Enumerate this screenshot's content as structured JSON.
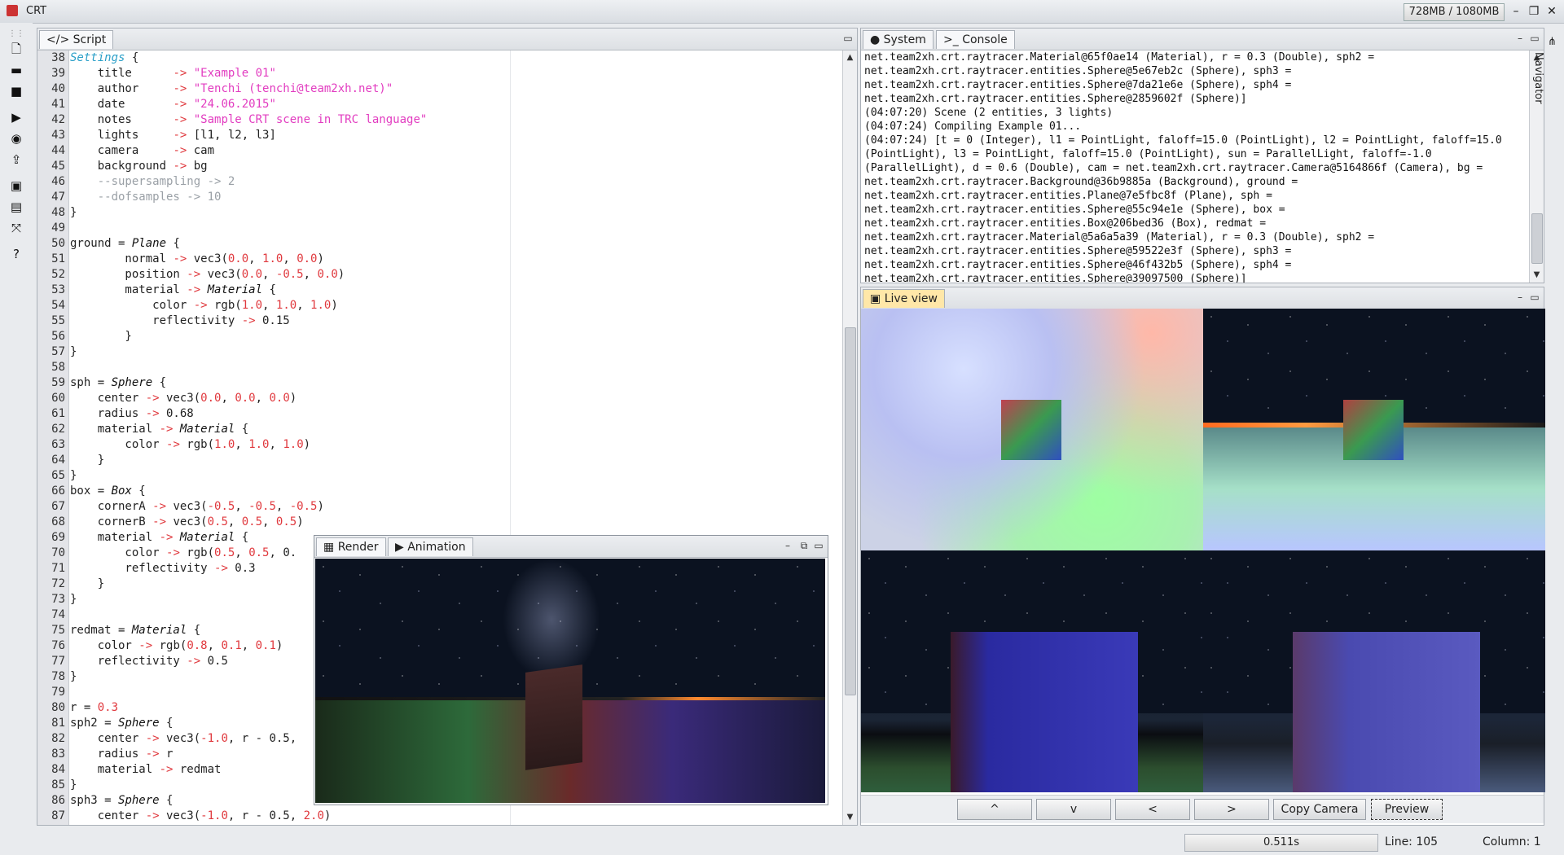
{
  "window": {
    "title": "CRT",
    "memory": "728MB / 1080MB"
  },
  "script_panel": {
    "tab_label": "Script",
    "line_numbers": [
      "38",
      "39",
      "40",
      "41",
      "42",
      "43",
      "44",
      "45",
      "46",
      "47",
      "48",
      "49",
      "50",
      "51",
      "52",
      "53",
      "54",
      "55",
      "56",
      "57",
      "58",
      "59",
      "60",
      "61",
      "62",
      "63",
      "64",
      "65",
      "66",
      "67",
      "68",
      "69",
      "70",
      "71",
      "72",
      "73",
      "74",
      "75",
      "76",
      "77",
      "78",
      "79",
      "80",
      "81",
      "82",
      "83",
      "84",
      "85",
      "86",
      "87"
    ],
    "code": [
      "Settings {",
      "    title      -> \"Example 01\"",
      "    author     -> \"Tenchi (tenchi@team2xh.net)\"",
      "    date       -> \"24.06.2015\"",
      "    notes      -> \"Sample CRT scene in TRC language\"",
      "    lights     -> [l1, l2, l3]",
      "    camera     -> cam",
      "    background -> bg",
      "    --supersampling -> 2",
      "    --dofsamples -> 10",
      "}",
      "",
      "ground = Plane {",
      "        normal -> vec3(0.0, 1.0, 0.0)",
      "        position -> vec3(0.0, -0.5, 0.0)",
      "        material -> Material {",
      "            color -> rgb(1.0, 1.0, 1.0)",
      "            reflectivity -> 0.15",
      "        }",
      "}",
      "",
      "sph = Sphere {",
      "    center -> vec3(0.0, 0.0, 0.0)",
      "    radius -> 0.68",
      "    material -> Material {",
      "        color -> rgb(1.0, 1.0, 1.0)",
      "    }",
      "}",
      "box = Box {",
      "    cornerA -> vec3(-0.5, -0.5, -0.5)",
      "    cornerB -> vec3(0.5, 0.5, 0.5)",
      "    material -> Material {",
      "        color -> rgb(0.5, 0.5, 0.",
      "        reflectivity -> 0.3",
      "    }",
      "}",
      "",
      "redmat = Material {",
      "    color -> rgb(0.8, 0.1, 0.1)",
      "    reflectivity -> 0.5",
      "}",
      "",
      "r = 0.3",
      "sph2 = Sphere {",
      "    center -> vec3(-1.0, r - 0.5,",
      "    radius -> r",
      "    material -> redmat",
      "}",
      "sph3 = Sphere {",
      "    center -> vec3(-1.0, r - 0.5, 2.0)"
    ]
  },
  "render_panel": {
    "tabs": [
      "Render",
      "Animation"
    ]
  },
  "right_top": {
    "tabs": [
      "System",
      "Console"
    ]
  },
  "console_lines": [
    "net.team2xh.crt.raytracer.Material@65f0ae14 (Material), r = 0.3 (Double), sph2 =",
    "net.team2xh.crt.raytracer.entities.Sphere@5e67eb2c (Sphere), sph3 =",
    "net.team2xh.crt.raytracer.entities.Sphere@7da21e6e (Sphere), sph4 =",
    "net.team2xh.crt.raytracer.entities.Sphere@2859602f (Sphere)]",
    "(04:07:20) Scene (2 entities, 3 lights)",
    "(04:07:24) Compiling Example 01...",
    "(04:07:24) [t = 0 (Integer), l1 = PointLight, faloff=15.0 (PointLight), l2 = PointLight, faloff=15.0",
    "(PointLight), l3 = PointLight, faloff=15.0 (PointLight), sun = ParallelLight, faloff=-1.0",
    "(ParallelLight), d = 0.6 (Double), cam = net.team2xh.crt.raytracer.Camera@5164866f (Camera), bg =",
    "net.team2xh.crt.raytracer.Background@36b9885a (Background), ground =",
    "net.team2xh.crt.raytracer.entities.Plane@7e5fbc8f (Plane), sph =",
    "net.team2xh.crt.raytracer.entities.Sphere@55c94e1e (Sphere), box =",
    "net.team2xh.crt.raytracer.entities.Box@206bed36 (Box), redmat =",
    "net.team2xh.crt.raytracer.Material@5a6a5a39 (Material), r = 0.3 (Double), sph2 =",
    "net.team2xh.crt.raytracer.entities.Sphere@59522e3f (Sphere), sph3 =",
    "net.team2xh.crt.raytracer.entities.Sphere@46f432b5 (Sphere), sph4 =",
    "net.team2xh.crt.raytracer.entities.Sphere@39097500 (Sphere)]"
  ],
  "live_view": {
    "tab_label": "Live view",
    "buttons": [
      "^",
      "v",
      "<",
      ">",
      "Copy Camera",
      "Preview"
    ]
  },
  "navigator_label": "Navigator",
  "status": {
    "render_time": "0.511s",
    "line": "Line: 105",
    "column": "Column: 1"
  }
}
